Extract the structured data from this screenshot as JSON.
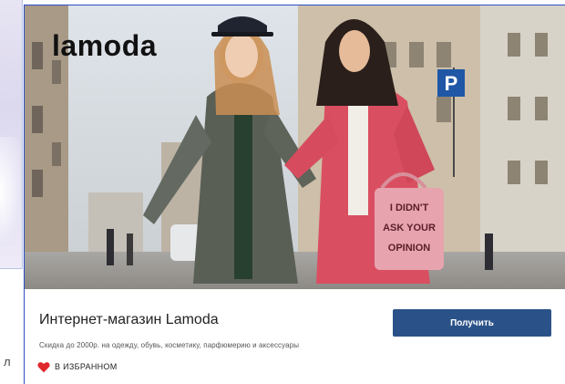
{
  "offer": {
    "brand_logo": "lamoda",
    "title": "Интернет-магазин Lamoda",
    "subtitle": "Скидка до 2000р. на одежду, обувь, косметику, парфюмерию и аксессуары",
    "cta_label": "Получить",
    "favorite_label": "В ИЗБРАННОМ",
    "bag_text": [
      "I DIDN'T",
      "ASK YOUR",
      "OPINION"
    ],
    "parking_sign": "P"
  },
  "left_card": {
    "visible_letter": "л"
  },
  "colors": {
    "accent": "#2b5288",
    "card_border": "#2a4fc9",
    "heart": "#e0272b"
  }
}
